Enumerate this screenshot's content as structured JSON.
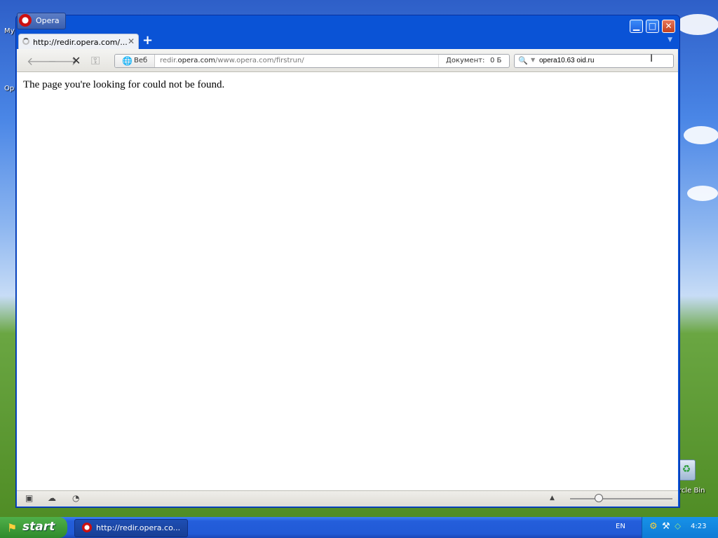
{
  "desktop": {
    "left_label_1": "My",
    "left_label_2": "Op",
    "recycle_bin_label": "rcle Bin"
  },
  "window": {
    "badge_label": "Opera",
    "controls": {
      "minimize": "▁",
      "maximize": "□",
      "close": "✕"
    }
  },
  "tabs": [
    {
      "title": "http://redir.opera.com/...",
      "close": "✕"
    }
  ],
  "new_tab": "+",
  "toolbar": {
    "site_button_label": "Веб",
    "url_host_prefix": "redir.",
    "url_host": "opera.com",
    "url_path": "/www.opera.com/firstrun/",
    "document_label": "Документ:",
    "document_size": "0 Б",
    "search_value": "opera10.63 oid.ru"
  },
  "content": {
    "message": "The page you're looking for could not be found."
  },
  "taskbar": {
    "start_label": "start",
    "task_title": "http://redir.opera.co...",
    "language": "EN",
    "clock": "4:23"
  }
}
